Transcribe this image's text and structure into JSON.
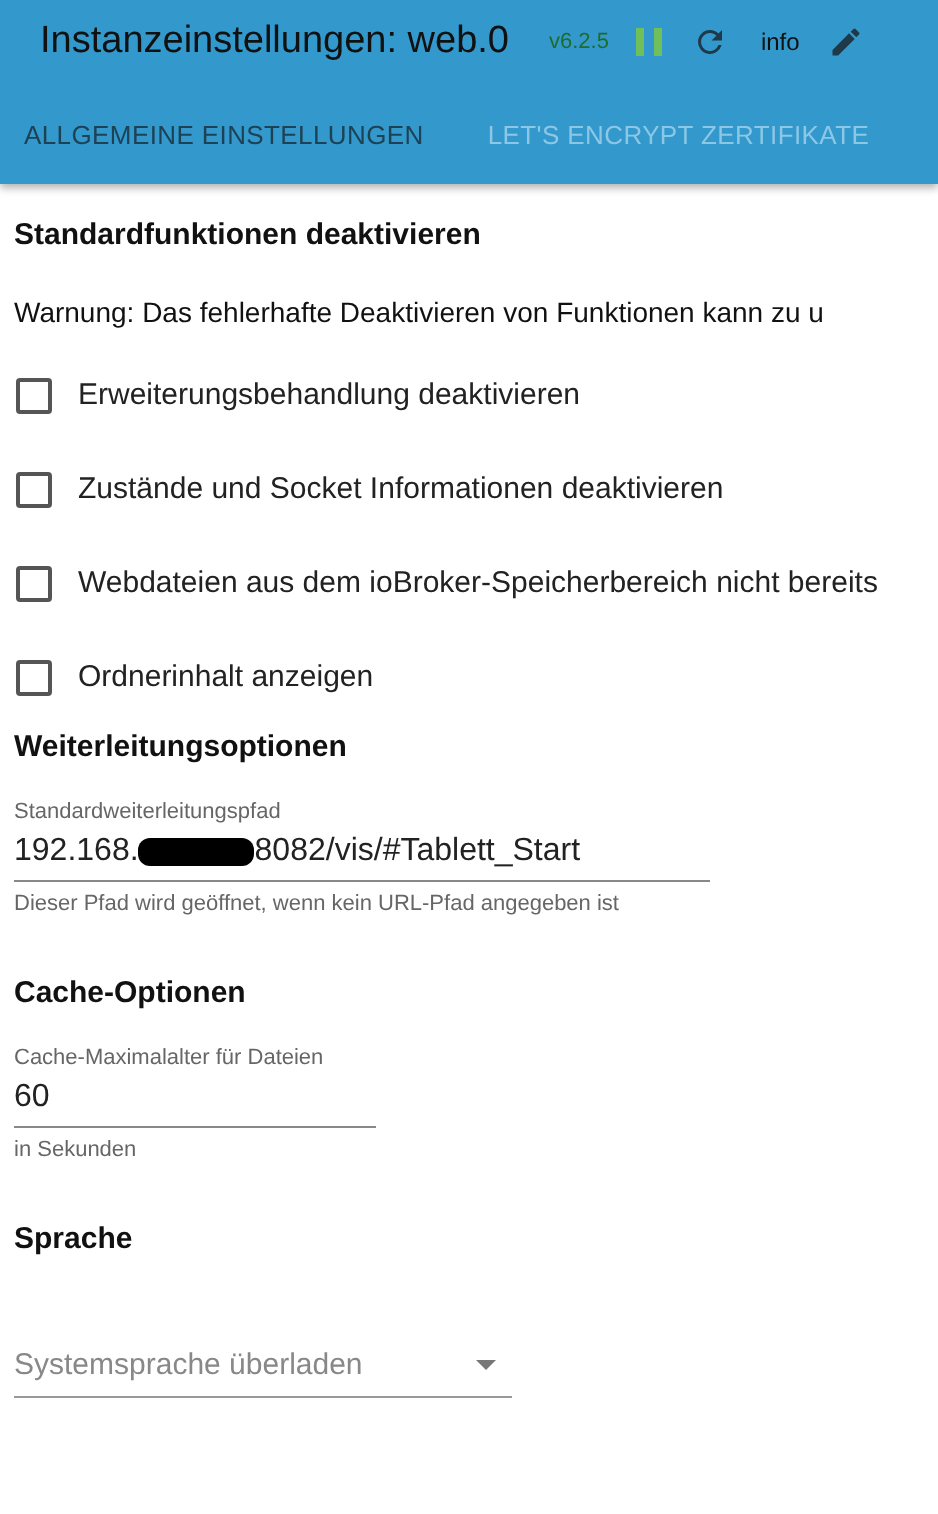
{
  "header": {
    "title": "Instanzeinstellungen: web.0",
    "version": "v6.2.5",
    "running": true,
    "info_label": "info"
  },
  "tabs": [
    {
      "label": "ALLGEMEINE EINSTELLUNGEN",
      "selected": true
    },
    {
      "label": "LET'S ENCRYPT ZERTIFIKATE",
      "selected": false
    }
  ],
  "sections": [
    {
      "kind": "checkboxes",
      "title": "Standardfunktionen deaktivieren",
      "warning": "Warnung: Das fehlerhafte Deaktivieren von Funktionen kann zu u",
      "options": [
        {
          "label": "Erweiterungsbehandlung deaktivieren",
          "checked": false
        },
        {
          "label": "Zustände und Socket Informationen deaktivieren",
          "checked": false
        },
        {
          "label": "Webdateien aus dem ioBroker-Speicherbereich nicht bereits",
          "checked": false
        },
        {
          "label": "Ordnerinhalt anzeigen",
          "checked": false
        }
      ]
    },
    {
      "kind": "text",
      "title": "Weiterleitungsoptionen",
      "label": "Standardweiterleitungspfad",
      "value_start": "192.168.",
      "redacted": true,
      "value_end": "8082/vis/#Tablett_Start",
      "helper": "Dieser Pfad wird geöffnet, wenn kein URL-Pfad angegeben ist",
      "wide": true
    },
    {
      "kind": "text",
      "title": "Cache-Optionen",
      "label": "Cache-Maximalalter für Dateien",
      "value_start": "60",
      "redacted": false,
      "helper": "in Sekunden",
      "wide": false
    },
    {
      "kind": "select",
      "title": "Sprache",
      "placeholder": "Systemsprache überladen"
    }
  ]
}
